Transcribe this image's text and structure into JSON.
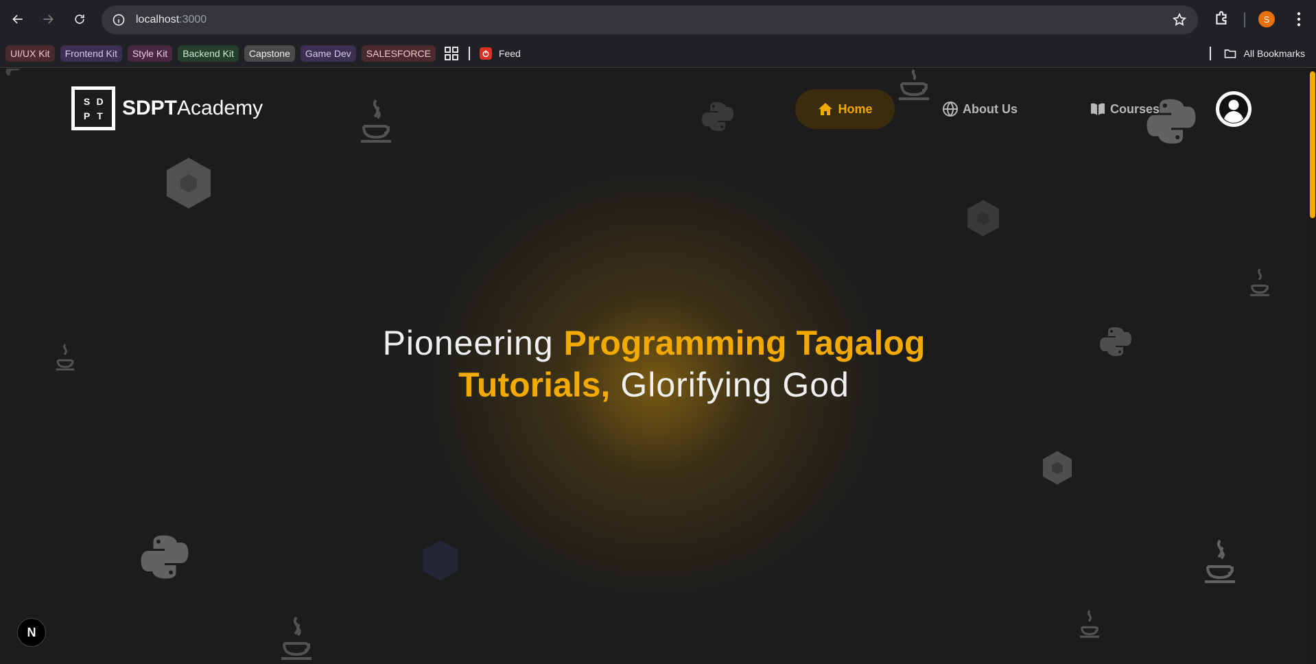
{
  "browser": {
    "url_host": "localhost",
    "url_port": ":3000",
    "profile_initial": "S",
    "bookmarks": [
      {
        "label": "UI/UX Kit"
      },
      {
        "label": "Frontend Kit"
      },
      {
        "label": "Style Kit"
      },
      {
        "label": "Backend Kit"
      },
      {
        "label": "Capstone"
      },
      {
        "label": "Game Dev"
      },
      {
        "label": "SALESFORCE"
      }
    ],
    "feed_label": "Feed",
    "all_bookmarks_label": "All Bookmarks"
  },
  "site": {
    "logo_letters": [
      "S",
      "D",
      "P",
      "T"
    ],
    "logo_bold": "SDPT",
    "logo_light": "Academy",
    "nav": {
      "home": "Home",
      "about": "About Us",
      "courses": "Courses"
    },
    "hero": {
      "part1": "Pioneering ",
      "part2": "Programming Tagalog",
      "part3": "Tutorials,",
      "part4": " Glorifying God"
    },
    "dev_badge": "N"
  },
  "colors": {
    "accent": "#f2a900",
    "background": "#1c1c1c"
  },
  "icons": {
    "background_decor": [
      "java-icon",
      "python-icon",
      "nodejs-icon"
    ]
  }
}
